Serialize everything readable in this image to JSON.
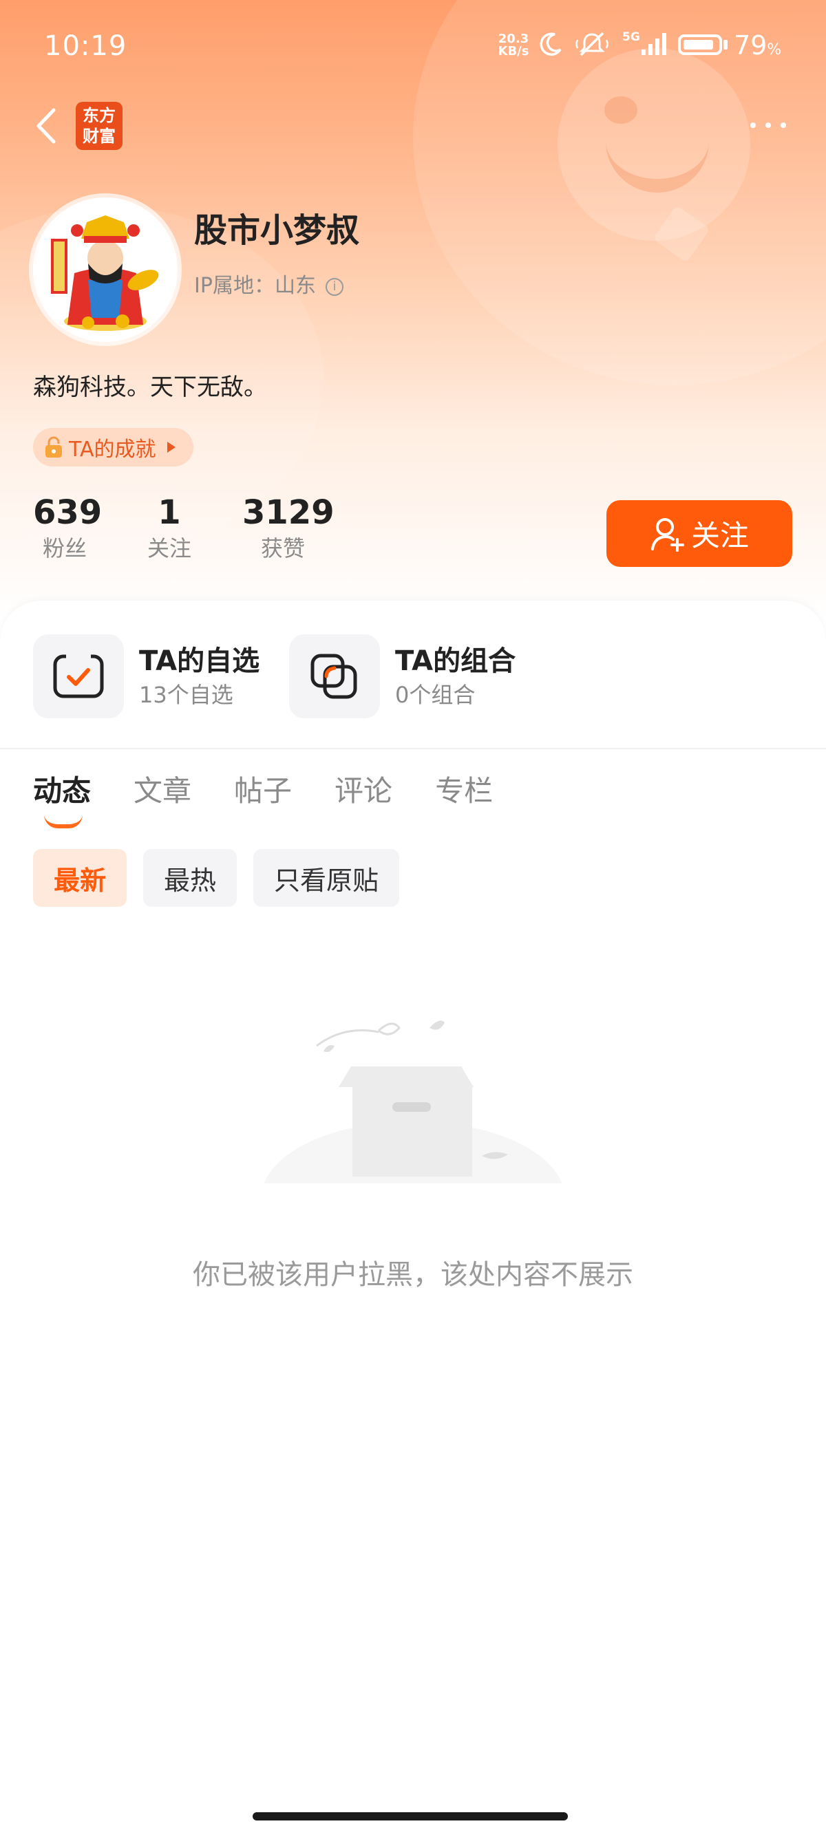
{
  "status_bar": {
    "time": "10:19",
    "net_speed_value": "20.3",
    "net_speed_unit": "KB/s",
    "signal_label": "5G",
    "battery_pct": "79",
    "battery_unit": "%"
  },
  "nav": {
    "logo_line1": "东方",
    "logo_line2": "财富"
  },
  "profile": {
    "username": "股市小梦叔",
    "ip_location": "IP属地：山东",
    "bio": "森狗科技。天下无敌。",
    "achievement_label": "TA的成就"
  },
  "stats": [
    {
      "value": "639",
      "label": "粉丝"
    },
    {
      "value": "1",
      "label": "关注"
    },
    {
      "value": "3129",
      "label": "获赞"
    }
  ],
  "follow_button": "关注",
  "quick_links": [
    {
      "title": "TA的自选",
      "subtitle": "13个自选"
    },
    {
      "title": "TA的组合",
      "subtitle": "0个组合"
    }
  ],
  "tabs": [
    "动态",
    "文章",
    "帖子",
    "评论",
    "专栏"
  ],
  "filters": [
    "最新",
    "最热",
    "只看原贴"
  ],
  "empty_message": "你已被该用户拉黑，该处内容不展示",
  "colors": {
    "accent": "#ff5b0a",
    "header_gradient_top": "#ff9e6b",
    "logo_red": "#e94e1b"
  }
}
